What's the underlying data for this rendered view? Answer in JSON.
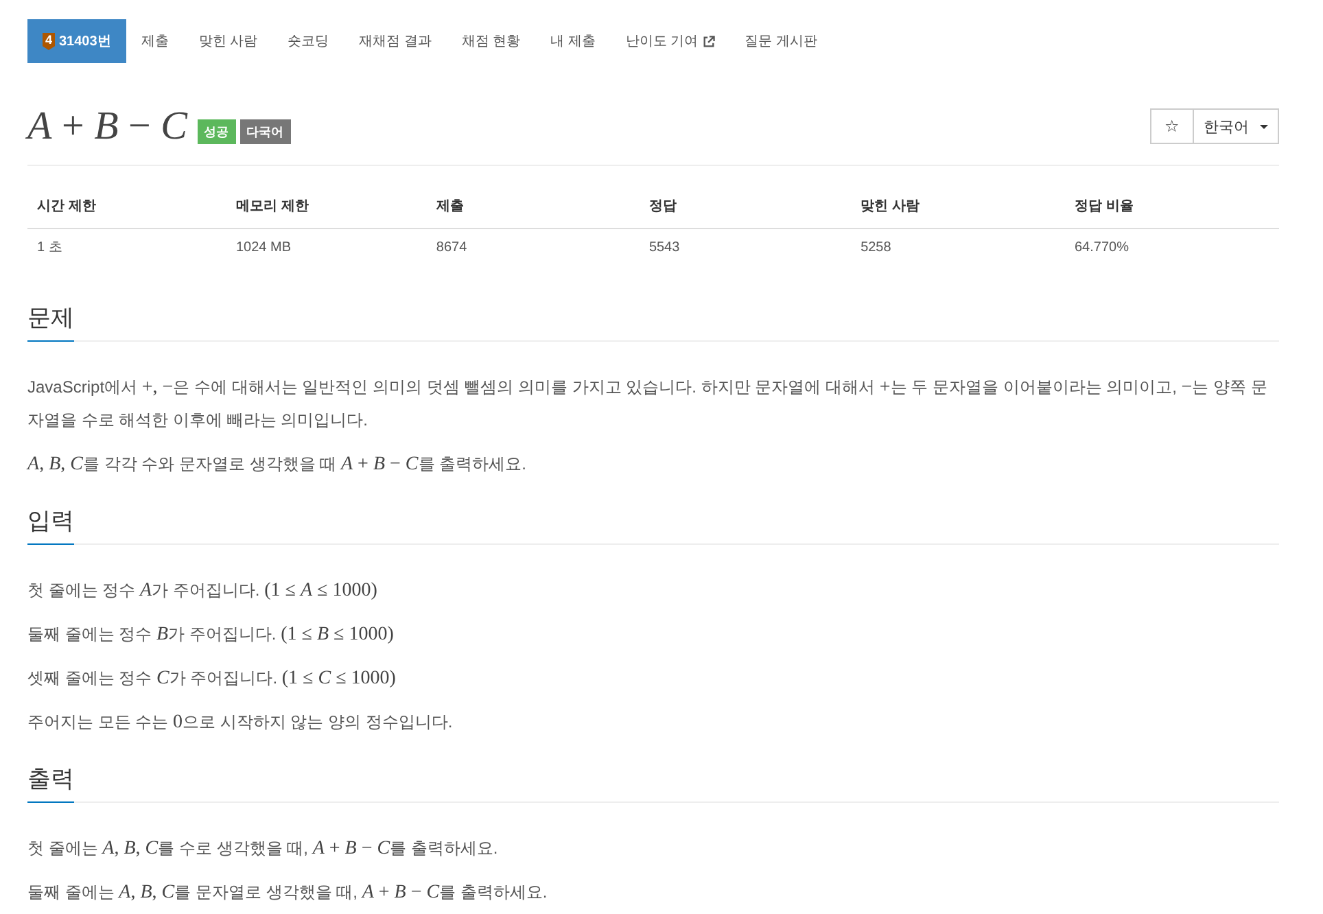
{
  "nav": {
    "tabs": [
      {
        "label": "31403번",
        "tier": "4",
        "selected": true,
        "external": false
      },
      {
        "label": "제출",
        "selected": false,
        "external": false
      },
      {
        "label": "맞힌 사람",
        "selected": false,
        "external": false
      },
      {
        "label": "숏코딩",
        "selected": false,
        "external": false
      },
      {
        "label": "재채점 결과",
        "selected": false,
        "external": false
      },
      {
        "label": "채점 현황",
        "selected": false,
        "external": false
      },
      {
        "label": "내 제출",
        "selected": false,
        "external": false
      },
      {
        "label": "난이도 기여",
        "selected": false,
        "external": true
      },
      {
        "label": "질문 게시판",
        "selected": false,
        "external": false
      }
    ]
  },
  "problem": {
    "title": "*A* + *B* − *C*",
    "tags": [
      {
        "label": "성공",
        "color": "#5cb85c"
      },
      {
        "label": "다국어",
        "color": "#777777"
      }
    ],
    "star": "☆",
    "language": "한국어"
  },
  "info_table": {
    "columns": [
      "시간 제한",
      "메모리 제한",
      "제출",
      "정답",
      "맞힌 사람",
      "정답 비율"
    ],
    "rows": [
      [
        "1 초",
        "1024 MB",
        "8674",
        "5543",
        "5258",
        "64.770%"
      ]
    ]
  },
  "sections": [
    {
      "title": "문제",
      "paragraphs": [
        [
          {
            "kind": "text",
            "text": "JavaScript에서 "
          },
          {
            "kind": "math",
            "text": "+, −"
          },
          {
            "kind": "text",
            "text": "은 수에 대해서는 일반적인 의미의 덧셈 뺄셈의 의미를 가지고 있습니다. 하지만 문자열에 대해서 "
          },
          {
            "kind": "math",
            "text": "+"
          },
          {
            "kind": "text",
            "text": "는 두 문자열을 이어붙이라는 의미이고, "
          },
          {
            "kind": "math",
            "text": "−"
          },
          {
            "kind": "text",
            "text": "는 양쪽 문자열을 수로 해석한 이후에 빼라는 의미입니다."
          }
        ],
        [
          {
            "kind": "var",
            "text": "A"
          },
          {
            "kind": "math",
            "text": ", "
          },
          {
            "kind": "var",
            "text": "B"
          },
          {
            "kind": "math",
            "text": ", "
          },
          {
            "kind": "var",
            "text": "C"
          },
          {
            "kind": "text",
            "text": "를 각각 수와 문자열로 생각했을 때 "
          },
          {
            "kind": "var",
            "text": "A"
          },
          {
            "kind": "math",
            "text": " + "
          },
          {
            "kind": "var",
            "text": "B"
          },
          {
            "kind": "math",
            "text": " − "
          },
          {
            "kind": "var",
            "text": "C"
          },
          {
            "kind": "text",
            "text": "를 출력하세요."
          }
        ]
      ]
    },
    {
      "title": "입력",
      "paragraphs": [
        [
          {
            "kind": "text",
            "text": "첫 줄에는 정수 "
          },
          {
            "kind": "var",
            "text": "A"
          },
          {
            "kind": "text",
            "text": "가 주어집니다. "
          },
          {
            "kind": "math",
            "text": "(1 ≤ "
          },
          {
            "kind": "var",
            "text": "A"
          },
          {
            "kind": "math",
            "text": " ≤ 1000)"
          }
        ],
        [
          {
            "kind": "text",
            "text": "둘째 줄에는 정수 "
          },
          {
            "kind": "var",
            "text": "B"
          },
          {
            "kind": "text",
            "text": "가 주어집니다. "
          },
          {
            "kind": "math",
            "text": "(1 ≤ "
          },
          {
            "kind": "var",
            "text": "B"
          },
          {
            "kind": "math",
            "text": " ≤ 1000)"
          }
        ],
        [
          {
            "kind": "text",
            "text": "셋째 줄에는 정수 "
          },
          {
            "kind": "var",
            "text": "C"
          },
          {
            "kind": "text",
            "text": "가 주어집니다. "
          },
          {
            "kind": "math",
            "text": "(1 ≤ "
          },
          {
            "kind": "var",
            "text": "C"
          },
          {
            "kind": "math",
            "text": " ≤ 1000)"
          }
        ],
        [
          {
            "kind": "text",
            "text": "주어지는 모든 수는 "
          },
          {
            "kind": "math",
            "text": "0"
          },
          {
            "kind": "text",
            "text": "으로 시작하지 않는 양의 정수입니다."
          }
        ]
      ]
    },
    {
      "title": "출력",
      "paragraphs": [
        [
          {
            "kind": "text",
            "text": "첫 줄에는 "
          },
          {
            "kind": "var",
            "text": "A"
          },
          {
            "kind": "math",
            "text": ", "
          },
          {
            "kind": "var",
            "text": "B"
          },
          {
            "kind": "math",
            "text": ", "
          },
          {
            "kind": "var",
            "text": "C"
          },
          {
            "kind": "text",
            "text": "를 수로 생각했을 때, "
          },
          {
            "kind": "var",
            "text": "A"
          },
          {
            "kind": "math",
            "text": " + "
          },
          {
            "kind": "var",
            "text": "B"
          },
          {
            "kind": "math",
            "text": " − "
          },
          {
            "kind": "var",
            "text": "C"
          },
          {
            "kind": "text",
            "text": "를 출력하세요."
          }
        ],
        [
          {
            "kind": "text",
            "text": "둘째 줄에는 "
          },
          {
            "kind": "var",
            "text": "A"
          },
          {
            "kind": "math",
            "text": ", "
          },
          {
            "kind": "var",
            "text": "B"
          },
          {
            "kind": "math",
            "text": ", "
          },
          {
            "kind": "var",
            "text": "C"
          },
          {
            "kind": "text",
            "text": "를 문자열로 생각했을 때, "
          },
          {
            "kind": "var",
            "text": "A"
          },
          {
            "kind": "math",
            "text": " + "
          },
          {
            "kind": "var",
            "text": "B"
          },
          {
            "kind": "math",
            "text": " − "
          },
          {
            "kind": "var",
            "text": "C"
          },
          {
            "kind": "text",
            "text": "를 출력하세요."
          }
        ]
      ]
    }
  ]
}
